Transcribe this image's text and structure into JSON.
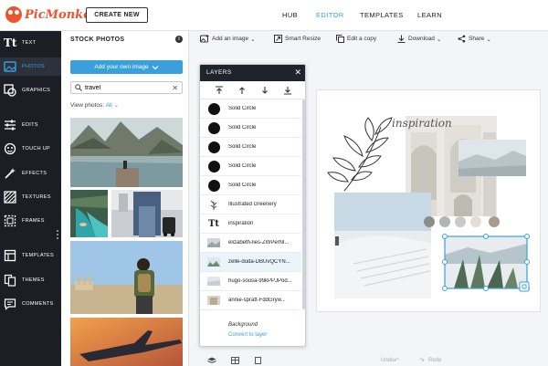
{
  "brand": {
    "name": "PicMonkey",
    "color": "#e8562f"
  },
  "header": {
    "create_button": "CREATE NEW",
    "nav": [
      {
        "label": "HUB",
        "active": false
      },
      {
        "label": "EDITOR",
        "active": true
      },
      {
        "label": "TEMPLATES",
        "active": false
      },
      {
        "label": "LEARN",
        "active": false
      }
    ]
  },
  "rail": {
    "items": [
      {
        "label": "TEXT",
        "icon": "text-icon"
      },
      {
        "label": "PHOTOS",
        "icon": "photos-icon",
        "active": true
      },
      {
        "label": "GRAPHICS",
        "icon": "graphics-icon"
      },
      {
        "label": "EDITS",
        "icon": "sliders-icon"
      },
      {
        "label": "TOUCH UP",
        "icon": "touch-up-icon"
      },
      {
        "label": "EFFECTS",
        "icon": "wand-icon"
      },
      {
        "label": "TEXTURES",
        "icon": "textures-icon"
      },
      {
        "label": "FRAMES",
        "icon": "frames-icon"
      },
      {
        "label": "TEMPLATES",
        "icon": "templates-icon"
      },
      {
        "label": "THEMES",
        "icon": "themes-icon"
      },
      {
        "label": "COMMENTS",
        "icon": "comments-icon"
      }
    ]
  },
  "stock_panel": {
    "title": "STOCK PHOTOS",
    "add_button": "Add your own image",
    "search_value": "travel",
    "view_photos_label": "View photos:",
    "view_photos_value": "All"
  },
  "toolbar": {
    "add_image": "Add an image",
    "smart_resize": "Smart Resize",
    "edit_copy": "Edit a copy",
    "download": "Download",
    "share": "Share"
  },
  "layers": {
    "title": "LAYERS",
    "items": [
      {
        "name": "Solid Circle",
        "icon": "circle"
      },
      {
        "name": "Solid Circle",
        "icon": "circle"
      },
      {
        "name": "Solid Circle",
        "icon": "circle"
      },
      {
        "name": "Solid Circle",
        "icon": "circle"
      },
      {
        "name": "Solid Circle",
        "icon": "circle"
      },
      {
        "name": "Illustrated Greenery",
        "icon": "leaf"
      },
      {
        "name": "inspiration",
        "icon": "text"
      },
      {
        "name": "elizabeth-lies-ZWPerNl...",
        "icon": "image"
      },
      {
        "name": "zelle-duda-DBUvQCYN...",
        "icon": "image",
        "selected": true
      },
      {
        "name": "hugo-sousa-99kPPJPod...",
        "icon": "image"
      },
      {
        "name": "annie-spratt-FddGryw...",
        "icon": "image"
      }
    ],
    "background_label": "Background",
    "convert_link": "Convert to layer"
  },
  "canvas": {
    "script_text": "inspiration",
    "swatches": [
      "#8b8e86",
      "#b3b5b0",
      "#c9cac5",
      "#e3ddd2",
      "#a79d8f"
    ]
  },
  "bottom": {
    "undo": "Undo",
    "redo": "Redo"
  }
}
